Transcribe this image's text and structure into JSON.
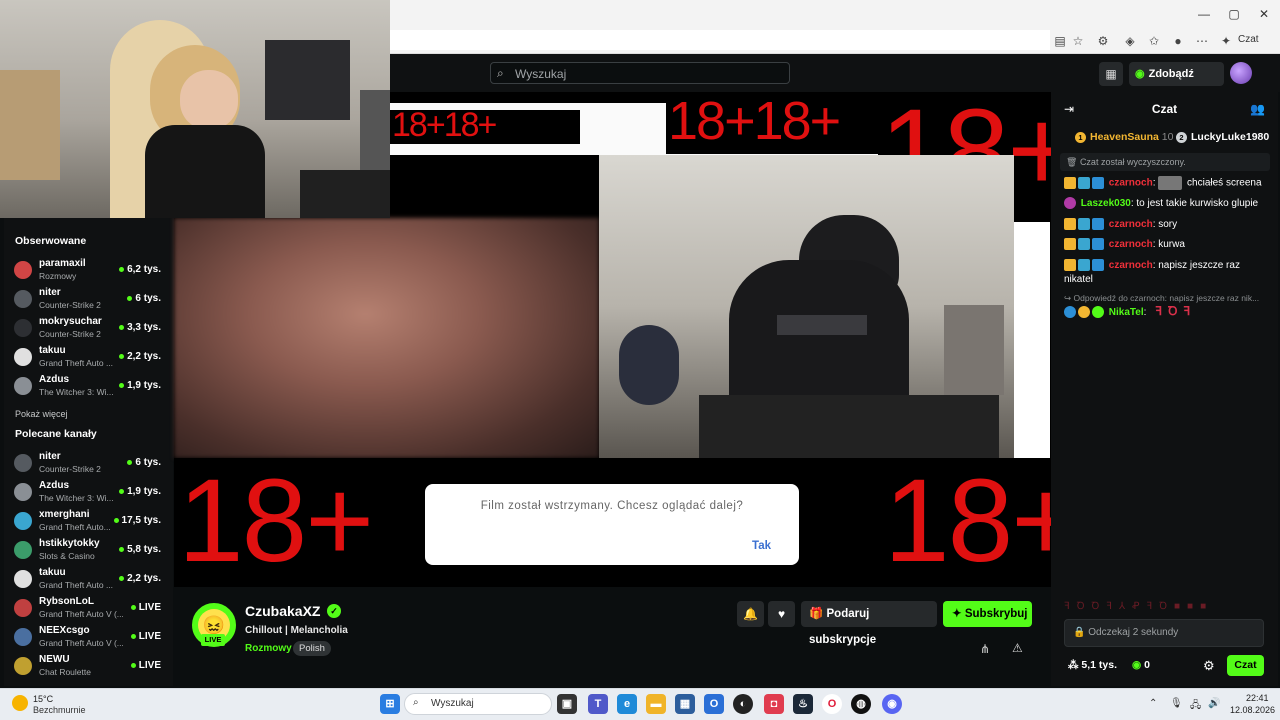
{
  "browser": {
    "copilot_label": "Czat",
    "window_controls": [
      "—",
      "▢",
      "✕"
    ]
  },
  "header": {
    "search_placeholder": "Wyszukaj",
    "kicks_label": "Zdobądź KICKs"
  },
  "sidebar": {
    "followed_heading": "Obserwowane",
    "followed": [
      {
        "name": "paramaxil",
        "category": "Rozmowy",
        "viewers": "6,2 tys.",
        "color": "#d04545"
      },
      {
        "name": "niter",
        "category": "Counter-Strike 2",
        "viewers": "6 tys.",
        "color": "#555a60"
      },
      {
        "name": "mokrysuchar",
        "category": "Counter-Strike 2",
        "viewers": "3,3 tys.",
        "color": "#2d2f33"
      },
      {
        "name": "takuu",
        "category": "Grand Theft Auto ...",
        "viewers": "2,2 tys.",
        "color": "#e0e0e0"
      },
      {
        "name": "Azdus",
        "category": "The Witcher 3: Wi...",
        "viewers": "1,9 tys.",
        "color": "#8a8f95"
      }
    ],
    "show_more": "Pokaż więcej",
    "recommended_heading": "Polecane kanały",
    "recommended": [
      {
        "name": "niter",
        "category": "Counter-Strike 2",
        "viewers": "6 tys.",
        "color": "#555a60"
      },
      {
        "name": "Azdus",
        "category": "The Witcher 3: Wi...",
        "viewers": "1,9 tys.",
        "color": "#8a8f95"
      },
      {
        "name": "xmerghani",
        "category": "Grand Theft Auto...",
        "viewers": "17,5 tys.",
        "color": "#3aa6d0"
      },
      {
        "name": "hstikkytokky",
        "category": "Slots & Casino",
        "viewers": "5,8 tys.",
        "color": "#3b9c6a"
      },
      {
        "name": "takuu",
        "category": "Grand Theft Auto ...",
        "viewers": "2,2 tys.",
        "color": "#e0e0e0"
      },
      {
        "name": "RybsonLoL",
        "category": "Grand Theft Auto V (...",
        "viewers": "LIVE",
        "color": "#c04040"
      },
      {
        "name": "NEEXcsgo",
        "category": "Grand Theft Auto V (...",
        "viewers": "LIVE",
        "color": "#4a6fa0"
      },
      {
        "name": "NEWU",
        "category": "Chat Roulette",
        "viewers": "LIVE",
        "color": "#c0a030"
      }
    ]
  },
  "stream": {
    "overlay_text": "18+",
    "pause_prompt": "Film został wstrzymany. Chcesz oglądać dalej?",
    "pause_confirm": "Tak"
  },
  "channel": {
    "name": "CzubakaXZ",
    "live_badge": "LIVE",
    "title": "Chillout | Melancholia",
    "category": "Rozmowy",
    "tag": "Polish",
    "gift_label": "Podaruj subskrypcje",
    "subscribe_label": "Subskrybuj"
  },
  "chat": {
    "title": "Czat",
    "leaderboard": [
      {
        "rank": "1",
        "name": "HeavenSauna",
        "count": "10",
        "color": "#f2b632"
      },
      {
        "rank": "2",
        "name": "LuckyLuke1980",
        "count": "",
        "color": "#cfd3d6"
      }
    ],
    "cleared_notice": "Czat został wyczyszczony.",
    "messages": [
      {
        "user": "czarnoch",
        "text": "chciałeś screena",
        "user_class": "un-red"
      },
      {
        "user": "Laszek030",
        "text": "to jest takie kurwisko glupie",
        "user_class": "un-green"
      },
      {
        "user": "czarnoch",
        "text": "sory",
        "user_class": "un-red"
      },
      {
        "user": "czarnoch",
        "text": "kurwa",
        "user_class": "un-red"
      },
      {
        "user": "czarnoch",
        "text": "napisz jeszcze raz nikatel",
        "user_class": "un-red"
      }
    ],
    "reply_context": "Odpowiedź do czarnoch: napisz jeszcze raz nik...",
    "reply_user": "NikaTel",
    "input_placeholder": "Odczekaj 2 sekundy",
    "viewers": "5,1 tys.",
    "kicks_count": "0",
    "send_label": "Czat"
  },
  "taskbar": {
    "weather_temp": "15°C",
    "weather_desc": "Bezchmurnie",
    "search_placeholder": "Wyszukaj",
    "time": "22:41",
    "date": "12.08.2026"
  }
}
